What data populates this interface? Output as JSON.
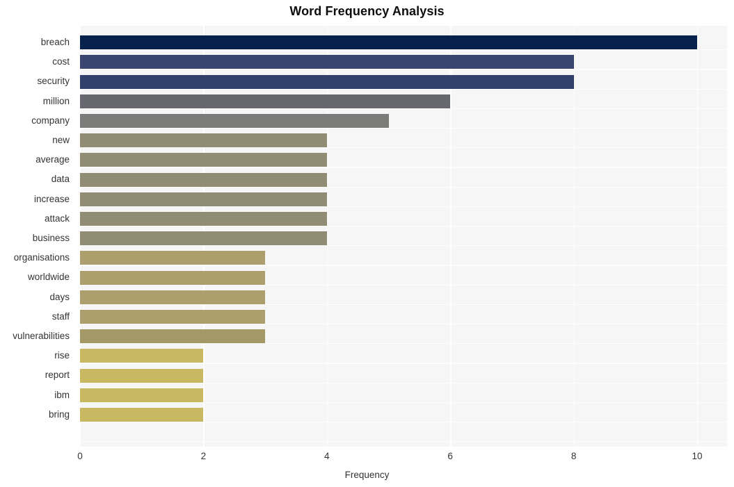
{
  "chart_data": {
    "type": "bar",
    "orientation": "horizontal",
    "title": "Word Frequency Analysis",
    "xlabel": "Frequency",
    "ylabel": "",
    "xlim": [
      0,
      10.49
    ],
    "ylim": null,
    "grid": true,
    "legend": null,
    "xticks": [
      "0",
      "2",
      "4",
      "6",
      "8",
      "10"
    ],
    "xtick_values": [
      0,
      2,
      4,
      6,
      8,
      10
    ],
    "categories": [
      "breach",
      "cost",
      "security",
      "million",
      "company",
      "new",
      "average",
      "data",
      "increase",
      "attack",
      "business",
      "organisations",
      "worldwide",
      "days",
      "staff",
      "vulnerabilities",
      "rise",
      "report",
      "ibm",
      "bring"
    ],
    "values": [
      10,
      8,
      8,
      6,
      5,
      4,
      4,
      4,
      4,
      4,
      4,
      3,
      3,
      3,
      3,
      3,
      2,
      2,
      2,
      2
    ],
    "bar_colors": [
      "#06224c",
      "#3a4570",
      "#32406c",
      "#66676f",
      "#7b7b79",
      "#918c74",
      "#918c74",
      "#918c74",
      "#918c74",
      "#918c74",
      "#918c74",
      "#ad9f6d",
      "#ad9f6d",
      "#ad9f6d",
      "#ad9f6d",
      "#a39868",
      "#c9b862",
      "#c9b862",
      "#c9b862",
      "#c9b862"
    ]
  },
  "style": {
    "page_background": "#ffffff",
    "plot_background": "#f6f6f7",
    "grid_color": "#ffffff",
    "title_color": "#0d0d0d",
    "tick_label_color": "#333333"
  }
}
